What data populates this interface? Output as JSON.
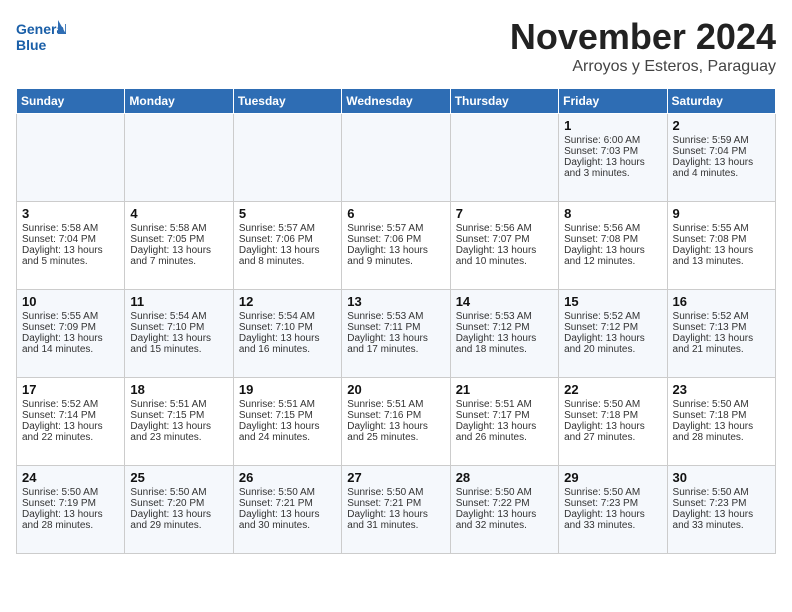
{
  "logo": {
    "line1": "General",
    "line2": "Blue"
  },
  "title": "November 2024",
  "subtitle": "Arroyos y Esteros, Paraguay",
  "days_header": [
    "Sunday",
    "Monday",
    "Tuesday",
    "Wednesday",
    "Thursday",
    "Friday",
    "Saturday"
  ],
  "weeks": [
    [
      {
        "day": "",
        "info": ""
      },
      {
        "day": "",
        "info": ""
      },
      {
        "day": "",
        "info": ""
      },
      {
        "day": "",
        "info": ""
      },
      {
        "day": "",
        "info": ""
      },
      {
        "day": "1",
        "info": "Sunrise: 6:00 AM\nSunset: 7:03 PM\nDaylight: 13 hours\nand 3 minutes."
      },
      {
        "day": "2",
        "info": "Sunrise: 5:59 AM\nSunset: 7:04 PM\nDaylight: 13 hours\nand 4 minutes."
      }
    ],
    [
      {
        "day": "3",
        "info": "Sunrise: 5:58 AM\nSunset: 7:04 PM\nDaylight: 13 hours\nand 5 minutes."
      },
      {
        "day": "4",
        "info": "Sunrise: 5:58 AM\nSunset: 7:05 PM\nDaylight: 13 hours\nand 7 minutes."
      },
      {
        "day": "5",
        "info": "Sunrise: 5:57 AM\nSunset: 7:06 PM\nDaylight: 13 hours\nand 8 minutes."
      },
      {
        "day": "6",
        "info": "Sunrise: 5:57 AM\nSunset: 7:06 PM\nDaylight: 13 hours\nand 9 minutes."
      },
      {
        "day": "7",
        "info": "Sunrise: 5:56 AM\nSunset: 7:07 PM\nDaylight: 13 hours\nand 10 minutes."
      },
      {
        "day": "8",
        "info": "Sunrise: 5:56 AM\nSunset: 7:08 PM\nDaylight: 13 hours\nand 12 minutes."
      },
      {
        "day": "9",
        "info": "Sunrise: 5:55 AM\nSunset: 7:08 PM\nDaylight: 13 hours\nand 13 minutes."
      }
    ],
    [
      {
        "day": "10",
        "info": "Sunrise: 5:55 AM\nSunset: 7:09 PM\nDaylight: 13 hours\nand 14 minutes."
      },
      {
        "day": "11",
        "info": "Sunrise: 5:54 AM\nSunset: 7:10 PM\nDaylight: 13 hours\nand 15 minutes."
      },
      {
        "day": "12",
        "info": "Sunrise: 5:54 AM\nSunset: 7:10 PM\nDaylight: 13 hours\nand 16 minutes."
      },
      {
        "day": "13",
        "info": "Sunrise: 5:53 AM\nSunset: 7:11 PM\nDaylight: 13 hours\nand 17 minutes."
      },
      {
        "day": "14",
        "info": "Sunrise: 5:53 AM\nSunset: 7:12 PM\nDaylight: 13 hours\nand 18 minutes."
      },
      {
        "day": "15",
        "info": "Sunrise: 5:52 AM\nSunset: 7:12 PM\nDaylight: 13 hours\nand 20 minutes."
      },
      {
        "day": "16",
        "info": "Sunrise: 5:52 AM\nSunset: 7:13 PM\nDaylight: 13 hours\nand 21 minutes."
      }
    ],
    [
      {
        "day": "17",
        "info": "Sunrise: 5:52 AM\nSunset: 7:14 PM\nDaylight: 13 hours\nand 22 minutes."
      },
      {
        "day": "18",
        "info": "Sunrise: 5:51 AM\nSunset: 7:15 PM\nDaylight: 13 hours\nand 23 minutes."
      },
      {
        "day": "19",
        "info": "Sunrise: 5:51 AM\nSunset: 7:15 PM\nDaylight: 13 hours\nand 24 minutes."
      },
      {
        "day": "20",
        "info": "Sunrise: 5:51 AM\nSunset: 7:16 PM\nDaylight: 13 hours\nand 25 minutes."
      },
      {
        "day": "21",
        "info": "Sunrise: 5:51 AM\nSunset: 7:17 PM\nDaylight: 13 hours\nand 26 minutes."
      },
      {
        "day": "22",
        "info": "Sunrise: 5:50 AM\nSunset: 7:18 PM\nDaylight: 13 hours\nand 27 minutes."
      },
      {
        "day": "23",
        "info": "Sunrise: 5:50 AM\nSunset: 7:18 PM\nDaylight: 13 hours\nand 28 minutes."
      }
    ],
    [
      {
        "day": "24",
        "info": "Sunrise: 5:50 AM\nSunset: 7:19 PM\nDaylight: 13 hours\nand 28 minutes."
      },
      {
        "day": "25",
        "info": "Sunrise: 5:50 AM\nSunset: 7:20 PM\nDaylight: 13 hours\nand 29 minutes."
      },
      {
        "day": "26",
        "info": "Sunrise: 5:50 AM\nSunset: 7:21 PM\nDaylight: 13 hours\nand 30 minutes."
      },
      {
        "day": "27",
        "info": "Sunrise: 5:50 AM\nSunset: 7:21 PM\nDaylight: 13 hours\nand 31 minutes."
      },
      {
        "day": "28",
        "info": "Sunrise: 5:50 AM\nSunset: 7:22 PM\nDaylight: 13 hours\nand 32 minutes."
      },
      {
        "day": "29",
        "info": "Sunrise: 5:50 AM\nSunset: 7:23 PM\nDaylight: 13 hours\nand 33 minutes."
      },
      {
        "day": "30",
        "info": "Sunrise: 5:50 AM\nSunset: 7:23 PM\nDaylight: 13 hours\nand 33 minutes."
      }
    ]
  ]
}
